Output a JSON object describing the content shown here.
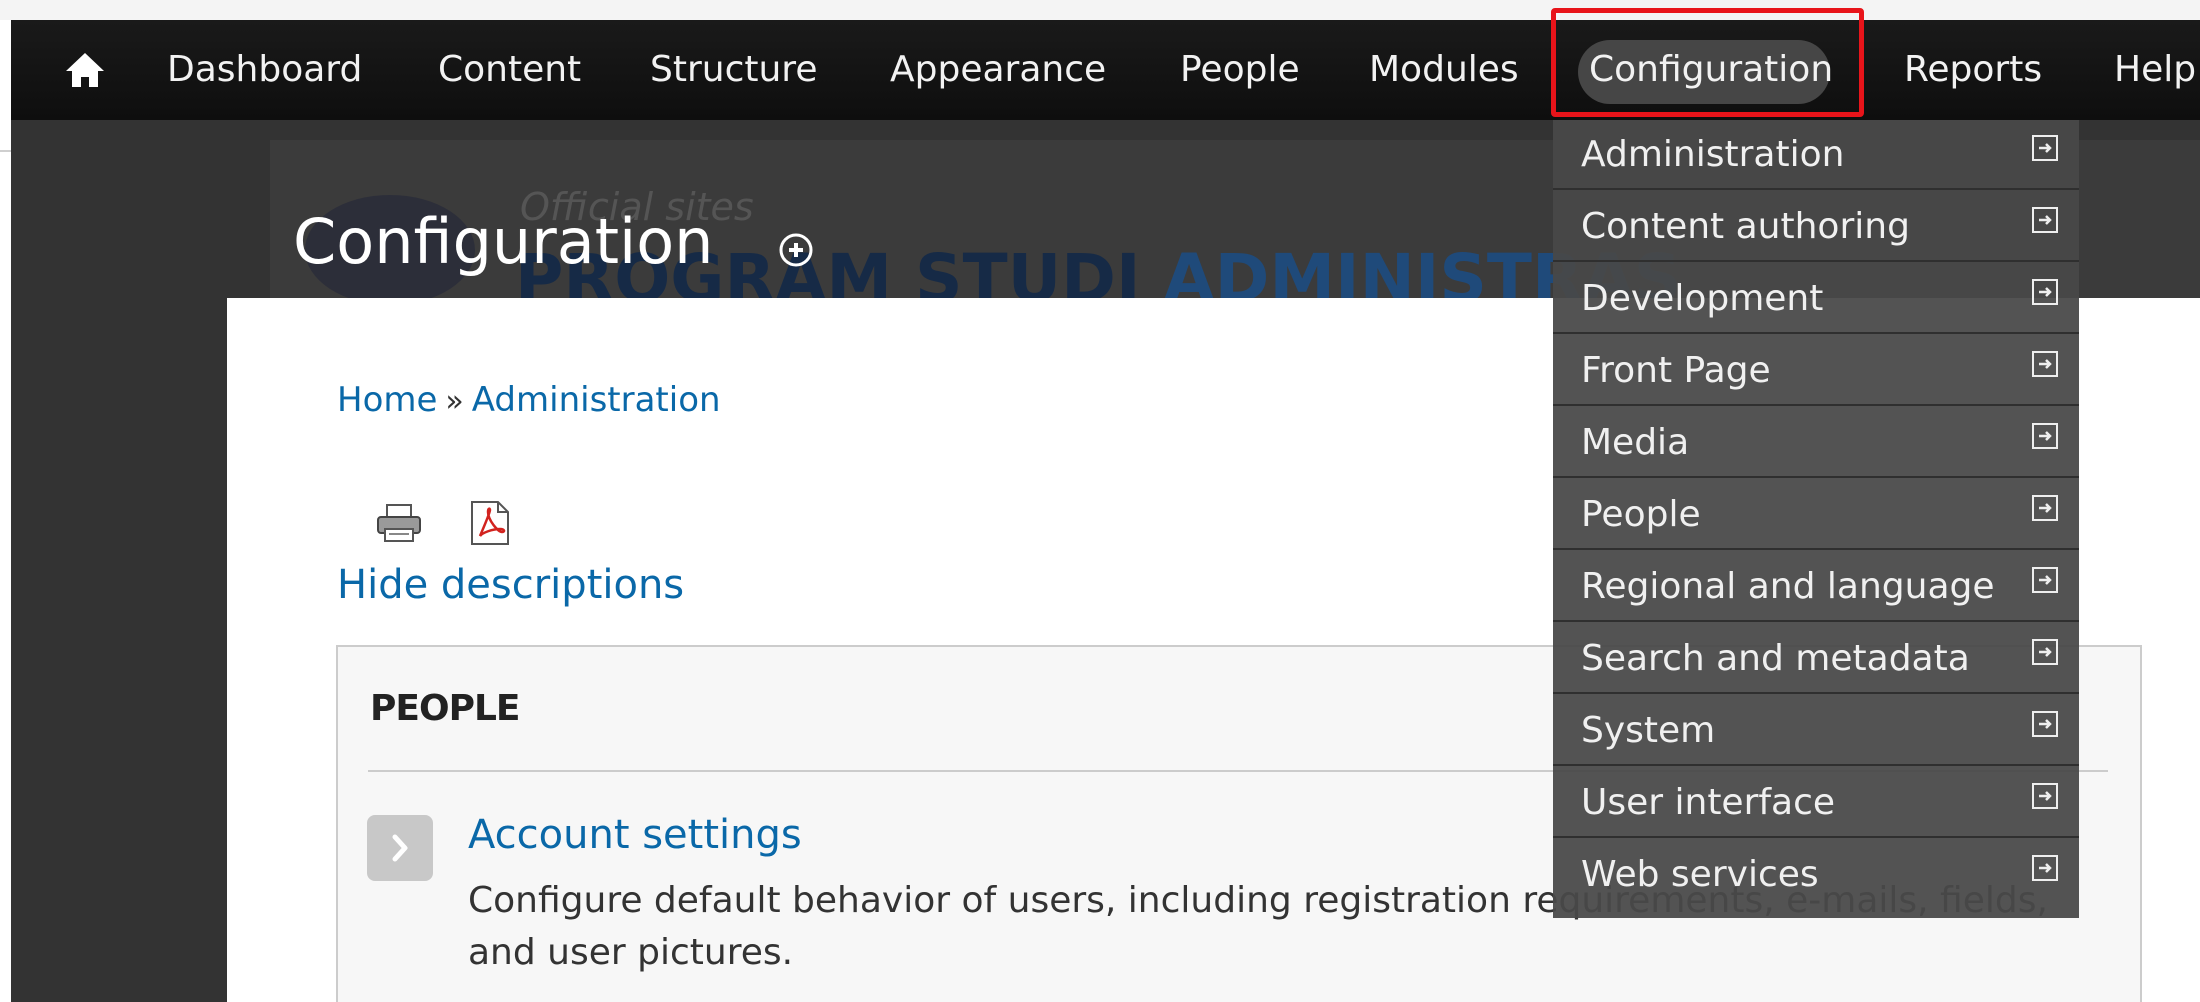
{
  "toolbar": {
    "items": [
      "Dashboard",
      "Content",
      "Structure",
      "Appearance",
      "People",
      "Modules",
      "Configuration",
      "Reports",
      "Help"
    ]
  },
  "banner": {
    "tagline": "Official sites",
    "name_part1": "PROGRAM STUDI ",
    "name_part2": "ADMINISTRAS"
  },
  "page": {
    "title": "Configuration"
  },
  "breadcrumb": {
    "home": "Home",
    "separator": "»",
    "admin": "Administration"
  },
  "hide_descriptions": "Hide descriptions",
  "section": {
    "title": "PEOPLE",
    "item_title": "Account settings",
    "item_desc": "Configure default behavior of users, including registration requirements, e-mails, fields, and user pictures."
  },
  "dropdown": {
    "items": [
      "Administration",
      "Content authoring",
      "Development",
      "Front Page",
      "Media",
      "People",
      "Regional and language",
      "Search and metadata",
      "System",
      "User interface",
      "Web services"
    ]
  },
  "colors": {
    "toolbar_bg": "#111111",
    "link": "#0a68a8",
    "highlight_border": "#e8141a",
    "dropdown_bg": "#484848"
  }
}
